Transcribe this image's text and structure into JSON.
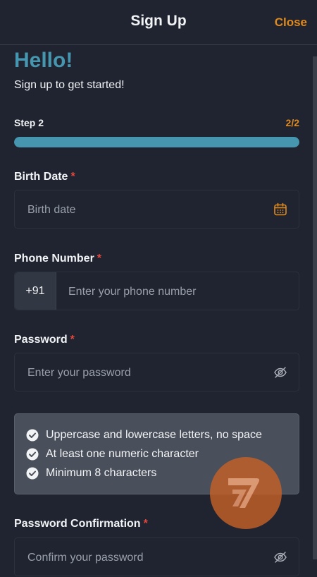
{
  "header": {
    "title": "Sign Up",
    "close_label": "Close"
  },
  "intro": {
    "greeting": "Hello!",
    "subtitle": "Sign up to get started!"
  },
  "progress": {
    "step_label": "Step 2",
    "step_count": "2/2",
    "fraction": 1.0
  },
  "fields": {
    "required_marker": "*",
    "birth_date": {
      "label": "Birth Date",
      "placeholder": "Birth date",
      "icon": "calendar-icon"
    },
    "phone": {
      "label": "Phone Number",
      "prefix": "+91",
      "placeholder": "Enter your phone number"
    },
    "password": {
      "label": "Password",
      "placeholder": "Enter your password",
      "icon": "eye-off-icon"
    },
    "password_confirmation": {
      "label": "Password Confirmation",
      "placeholder": "Confirm your password",
      "icon": "eye-off-icon"
    }
  },
  "password_rules": [
    {
      "text": "Uppercase and lowercase letters, no space",
      "icon": "check-circle-icon"
    },
    {
      "text": "At least one numeric character",
      "icon": "check-circle-icon"
    },
    {
      "text": "Minimum 8 characters",
      "icon": "check-circle-icon"
    }
  ],
  "fab": {
    "icon": "logo-mark-icon"
  },
  "colors": {
    "background": "#1f2430",
    "accent_blue": "#4796b0",
    "accent_orange": "#e08a1e",
    "required_red": "#e0483e",
    "rules_panel": "#4a505b"
  }
}
